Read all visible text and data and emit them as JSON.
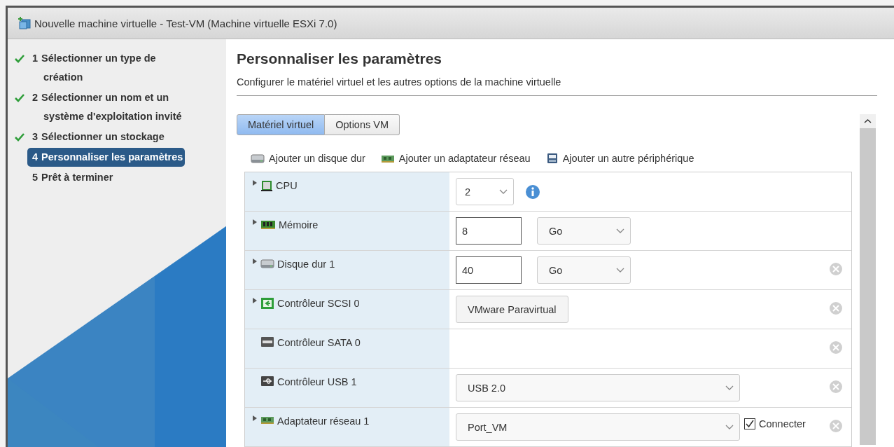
{
  "window": {
    "title": "Nouvelle machine virtuelle - Test-VM (Machine virtuelle ESXi 7.0)"
  },
  "steps": [
    {
      "number": "1",
      "label": "Sélectionner un type de création",
      "done": true,
      "selected": false
    },
    {
      "number": "2",
      "label": "Sélectionner un nom et un système d'exploitation invité",
      "done": true,
      "selected": false
    },
    {
      "number": "3",
      "label": "Sélectionner un stockage",
      "done": true,
      "selected": false
    },
    {
      "number": "4",
      "label": "Personnaliser les paramètres",
      "done": false,
      "selected": true
    },
    {
      "number": "5",
      "label": "Prêt à terminer",
      "done": false,
      "selected": false
    }
  ],
  "heading": "Personnaliser les paramètres",
  "subtitle": "Configurer le matériel virtuel et les autres options de la machine virtuelle",
  "tabs": [
    {
      "label": "Matériel virtuel",
      "selected": true
    },
    {
      "label": "Options VM",
      "selected": false
    }
  ],
  "toolbar": [
    {
      "kind": "disk",
      "label": "Ajouter un disque dur"
    },
    {
      "kind": "network",
      "label": "Ajouter un adaptateur réseau"
    },
    {
      "kind": "device",
      "label": "Ajouter un autre périphérique"
    }
  ],
  "devices": [
    {
      "kind": "cpu",
      "label": "CPU",
      "expandable": true,
      "removable": false,
      "controls": [
        {
          "kind": "select-small",
          "value": "2"
        },
        {
          "kind": "info"
        }
      ]
    },
    {
      "kind": "memory",
      "label": "Mémoire",
      "expandable": true,
      "removable": false,
      "controls": [
        {
          "kind": "number",
          "value": "8"
        },
        {
          "kind": "unit-select",
          "value": "Go"
        }
      ]
    },
    {
      "kind": "disk",
      "label": "Disque dur 1",
      "expandable": true,
      "removable": true,
      "controls": [
        {
          "kind": "number",
          "value": "40"
        },
        {
          "kind": "unit-select",
          "value": "Go"
        }
      ]
    },
    {
      "kind": "scsi",
      "label": "Contrôleur SCSI 0",
      "expandable": true,
      "removable": true,
      "controls": [
        {
          "kind": "readonly",
          "value": "VMware Paravirtual"
        }
      ]
    },
    {
      "kind": "sata",
      "label": "Contrôleur SATA 0",
      "expandable": false,
      "removable": true
    },
    {
      "kind": "usb",
      "label": "Contrôleur USB 1",
      "expandable": false,
      "removable": true,
      "controls": [
        {
          "kind": "select-wide",
          "value": "USB 2.0"
        }
      ]
    },
    {
      "kind": "network",
      "label": "Adaptateur réseau 1",
      "expandable": true,
      "removable": true,
      "controls": [
        {
          "kind": "select-wide",
          "value": "Port_VM"
        },
        {
          "kind": "checkbox",
          "label": "Connecter",
          "checked": true
        }
      ]
    }
  ]
}
